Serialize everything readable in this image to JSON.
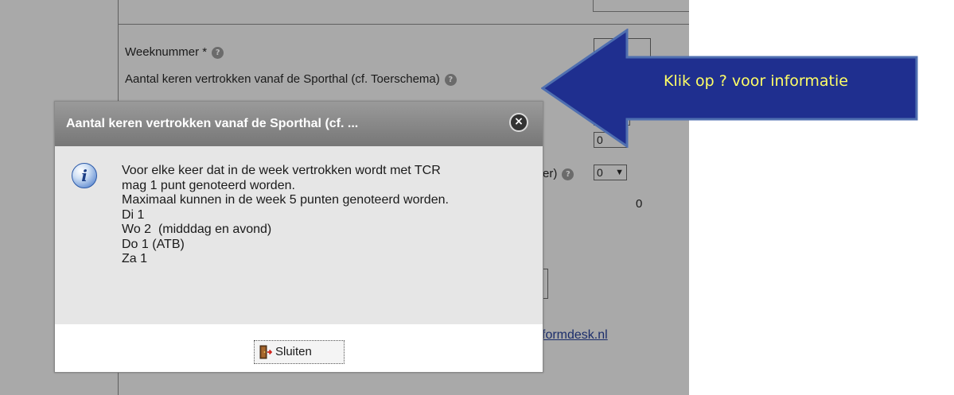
{
  "form": {
    "week_label": "Weeknummer *",
    "departures_label": "Aantal keren vertrokken vanaf de Sporthal (cf. Toerschema)",
    "partial_text": "er)",
    "select_value_1": "0",
    "select_value_2": "0",
    "total_value": "0",
    "link_text": "formdesk.nl",
    "help_icon_glyph": "?"
  },
  "dialog": {
    "title": "Aantal keren vertrokken vanaf de Sporthal (cf. ...",
    "close_glyph": "×",
    "info_glyph": "i",
    "body_lines": [
      "Voor elke keer dat in de week vertrokken wordt met TCR",
      "mag 1 punt genoteerd worden.",
      "Maximaal kunnen in de week 5 punten genoteerd worden.",
      "Di 1",
      "Wo 2  (midddag en avond)",
      "Do 1 (ATB)",
      "Za 1"
    ],
    "close_button_label": "Sluiten"
  },
  "annotation": {
    "text": "Klik op ? voor informatie",
    "arrow_color": "#1f2f8f",
    "text_color": "#ffff66"
  },
  "icons": {
    "help": "help-icon",
    "close": "close-icon",
    "info": "info-icon",
    "exit": "exit-door-icon"
  }
}
